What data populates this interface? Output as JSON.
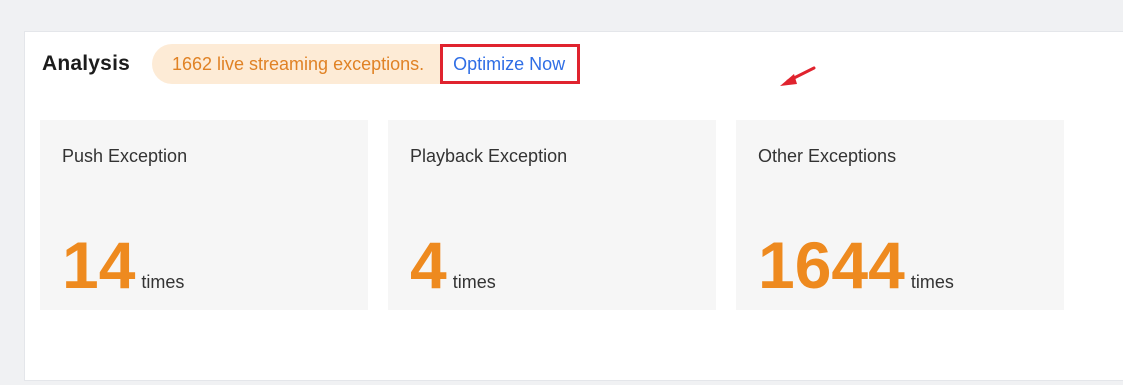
{
  "analysis": {
    "title": "Analysis",
    "alert_text": "1662 live streaming exceptions.",
    "optimize_label": "Optimize Now"
  },
  "cards": [
    {
      "label": "Push Exception",
      "count": "14",
      "unit": "times"
    },
    {
      "label": "Playback Exception",
      "count": "4",
      "unit": "times"
    },
    {
      "label": "Other Exceptions",
      "count": "1644",
      "unit": "times"
    }
  ],
  "colors": {
    "accent_orange": "#ee8a1f",
    "alert_background": "#fdebd6",
    "alert_text": "#e08225",
    "link_blue": "#2f6ee5",
    "highlight_red": "#e0232e"
  },
  "icons": {
    "annotation": "red-arrow-icon"
  }
}
